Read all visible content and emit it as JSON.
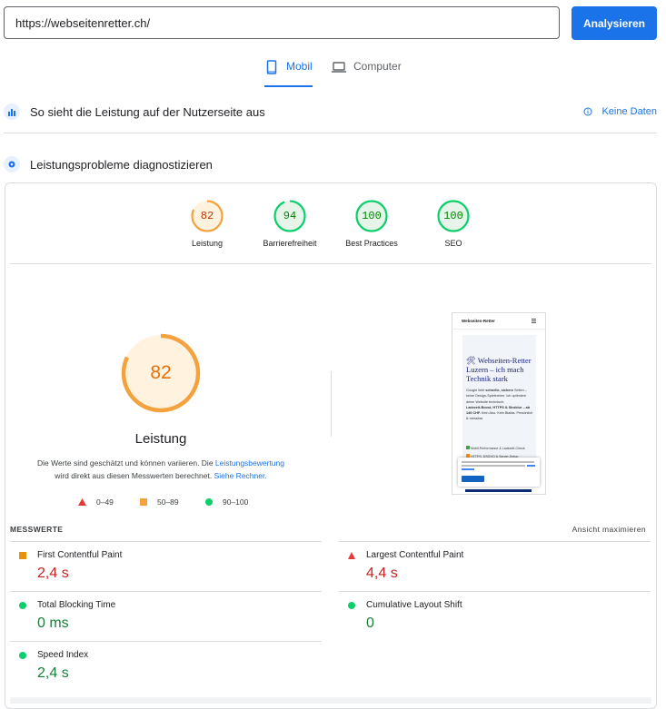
{
  "search": {
    "url": "https://webseitenretter.ch/",
    "analyze_label": "Analysieren"
  },
  "tabs": [
    {
      "label": "Mobil",
      "active": true
    },
    {
      "label": "Computer",
      "active": false
    }
  ],
  "field_section": {
    "title": "So sieht die Leistung auf der Nutzerseite aus",
    "no_data_label": "Keine Daten"
  },
  "diagnose_section": {
    "title": "Leistungsprobleme diagnostizieren"
  },
  "scores": [
    {
      "value": "82",
      "label": "Leistung",
      "status": "average"
    },
    {
      "value": "94",
      "label": "Barrierefreiheit",
      "status": "pass"
    },
    {
      "value": "100",
      "label": "Best Practices",
      "status": "pass"
    },
    {
      "value": "100",
      "label": "SEO",
      "status": "pass"
    }
  ],
  "performance": {
    "score": "82",
    "title": "Leistung",
    "desc_1": "Die Werte sind geschätzt und können variieren. Die ",
    "desc_link_1": "Leistungsbewertung",
    "desc_2": "wird direkt aus diesen Messwerten berechnet. ",
    "desc_link_2": "Siehe Rechner.",
    "legend": [
      {
        "range": "0–49",
        "shape": "triangle",
        "color": "#e53935"
      },
      {
        "range": "50–89",
        "shape": "square",
        "color": "#f4a23d"
      },
      {
        "range": "90–100",
        "shape": "circle",
        "color": "#0cce6b"
      }
    ]
  },
  "screenshot": {
    "site_name": "Webseiten-Retter",
    "heading_emoji": "🛠",
    "heading": "Webseiten-Retter Luzern – ich mach Technik stark",
    "body_1": "Google liebt ",
    "body_bold_1": "schnelle, sichere",
    "body_2": " Seiten – keine Design-Spielereien. Ich optimiere deine Website technisch:",
    "body_bold_2": "Ladezeit-Boost, HTTPS & Struktur – ab 149 CHF.",
    "body_3": " Kein Abo. Kein Blabla. Persönlich & messbar.",
    "check_1": "Mobil-Performance & Ladezeit-Check",
    "check_2": "HTTPS, DSGVO & Server-Setup"
  },
  "metrics_section": {
    "title": "MESSWERTE",
    "expand_label": "Ansicht maximieren"
  },
  "metrics": [
    {
      "name": "First Contentful Paint",
      "value": "2,4 s",
      "status": "average",
      "color": "#c5221f"
    },
    {
      "name": "Largest Contentful Paint",
      "value": "4,4 s",
      "status": "fail",
      "color": "#c5221f"
    },
    {
      "name": "Total Blocking Time",
      "value": "0 ms",
      "status": "pass",
      "color": "#188038"
    },
    {
      "name": "Cumulative Layout Shift",
      "value": "0",
      "status": "pass",
      "color": "#188038"
    },
    {
      "name": "Speed Index",
      "value": "2,4 s",
      "status": "pass",
      "color": "#188038"
    }
  ]
}
